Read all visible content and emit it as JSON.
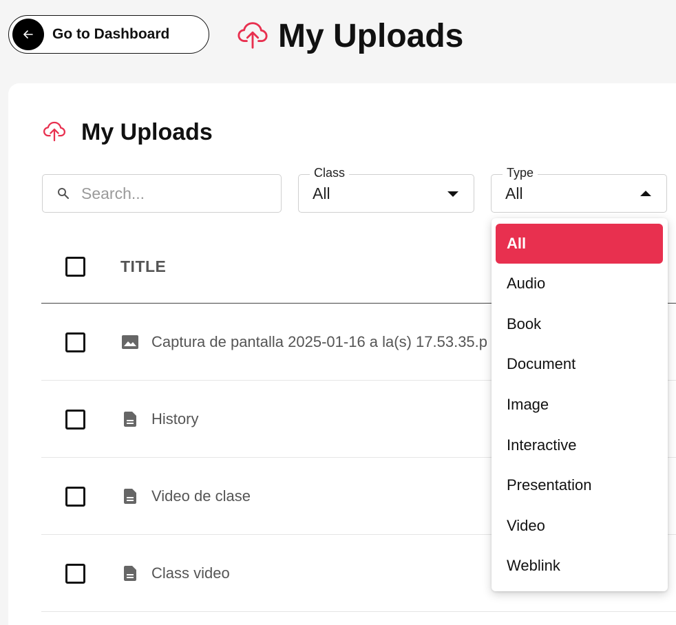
{
  "header": {
    "back_label": "Go to Dashboard",
    "title": "My Uploads"
  },
  "card": {
    "title": "My Uploads"
  },
  "search": {
    "placeholder": "Search..."
  },
  "filters": {
    "class": {
      "label": "Class",
      "value": "All"
    },
    "type": {
      "label": "Type",
      "value": "All"
    }
  },
  "table": {
    "title_header": "TITLE",
    "rows": [
      {
        "icon": "image-icon",
        "title": "Captura de pantalla 2025-01-16 a la(s) 17.53.35.p"
      },
      {
        "icon": "document-icon",
        "title": "History"
      },
      {
        "icon": "document-icon",
        "title": "Video de clase"
      },
      {
        "icon": "document-icon",
        "title": "Class video"
      }
    ]
  },
  "type_dropdown": {
    "options": [
      "All",
      "Audio",
      "Book",
      "Document",
      "Image",
      "Interactive",
      "Presentation",
      "Video",
      "Weblink"
    ],
    "selected": "All"
  },
  "colors": {
    "accent": "#e8304f",
    "text": "#111111",
    "muted": "#555555"
  }
}
